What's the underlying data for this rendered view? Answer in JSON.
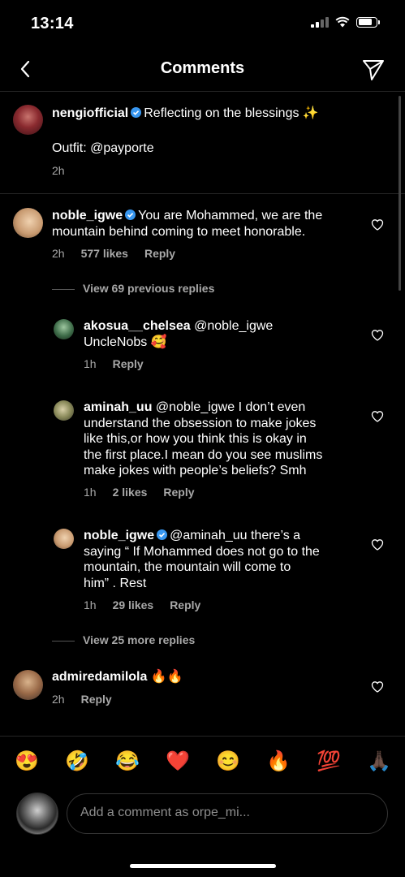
{
  "status": {
    "time": "13:14"
  },
  "header": {
    "title": "Comments",
    "back_icon": "chevron-left-icon",
    "send_icon": "paper-plane-icon"
  },
  "caption": {
    "username": "nengiofficial",
    "text": "Reflecting on the blessings ✨",
    "outfit": "Outfit: @payporte",
    "time": "2h"
  },
  "comments": [
    {
      "username": "noble_igwe",
      "text_line1": "You are Mohammed, we are the",
      "text_line2": "mountain behind coming to meet honorable.",
      "time": "2h",
      "likes": "577 likes",
      "reply": "Reply",
      "view_previous": "View 69 previous replies",
      "replies": [
        {
          "username": "akosua__chelsea",
          "text_line1": "@noble_igwe",
          "text_line2": "UncleNobs 🥰",
          "time": "1h",
          "reply": "Reply"
        },
        {
          "username": "aminah_uu",
          "text_line1": "@noble_igwe I don’t even",
          "text_line2": "understand the obsession to make jokes",
          "text_line3": "like this,or how you think this is okay in",
          "text_line4": "the first place.I mean do you see muslims",
          "text_line5": "make jokes with people’s beliefs? Smh",
          "time": "1h",
          "likes": "2 likes",
          "reply": "Reply"
        },
        {
          "username": "noble_igwe",
          "text_line1": "@aminah_uu there’s a",
          "text_line2": "saying “ If Mohammed does not go to the",
          "text_line3": "mountain, the mountain will come to",
          "text_line4": "him” . Rest",
          "time": "1h",
          "likes": "29 likes",
          "reply": "Reply"
        }
      ],
      "view_more": "View 25 more replies"
    },
    {
      "username": "admiredamilola",
      "text": "🔥🔥",
      "time": "2h",
      "reply": "Reply"
    }
  ],
  "emoji_bar": [
    "😍",
    "🤣",
    "😂",
    "❤️",
    "😊",
    "🔥",
    "💯",
    "🙏🏿"
  ],
  "composer": {
    "placeholder": "Add a comment as orpe_mi..."
  },
  "colors": {
    "background": "#000000",
    "secondary_text": "#a8a8a8",
    "verified": "#3897f0",
    "divider": "#262626"
  }
}
